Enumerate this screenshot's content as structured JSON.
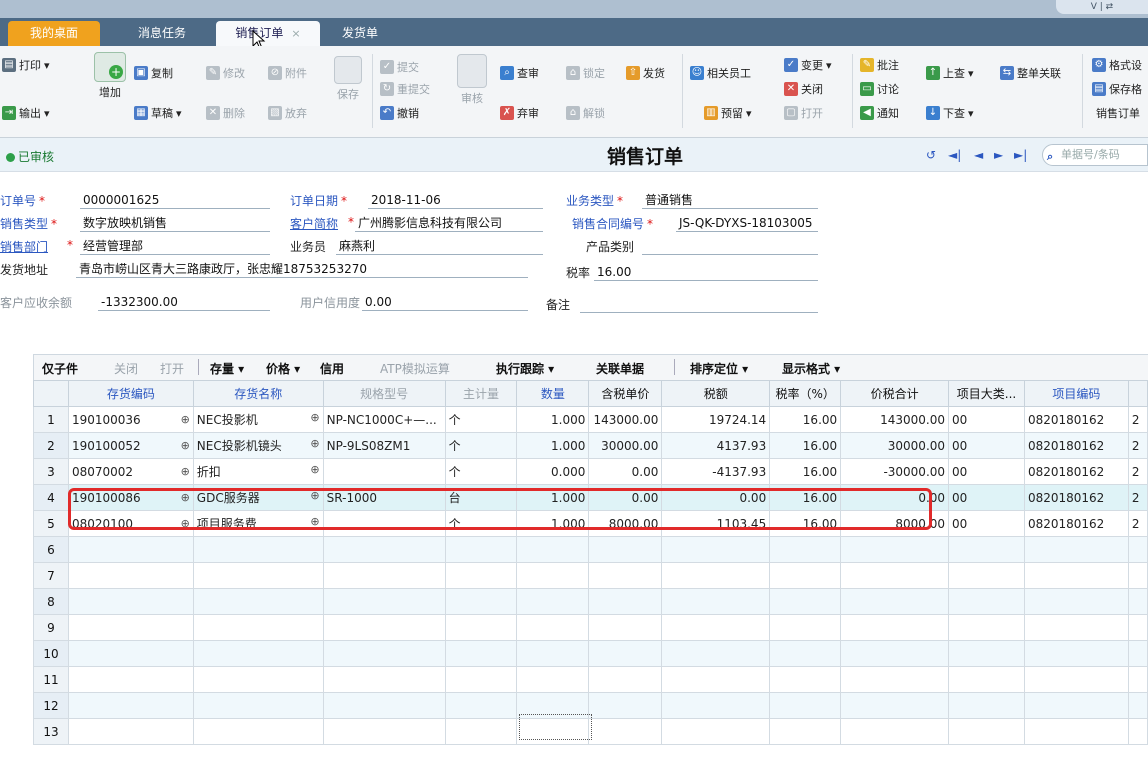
{
  "tabs": [
    {
      "label": "我的桌面"
    },
    {
      "label": "消息任务"
    },
    {
      "label": "销售订单",
      "close": "×"
    },
    {
      "label": "发货单"
    }
  ],
  "window_widget": "ᐯ | ⇄",
  "toolbar": {
    "print": "打印",
    "export": "输出",
    "add": "增加",
    "copy": "复制",
    "draft": "草稿",
    "modify": "修改",
    "attach": "附件",
    "delete": "删除",
    "discard": "放弃",
    "save": "保存",
    "submit": "提交",
    "resubmit": "重提交",
    "revoke": "撤销",
    "audit": "审核",
    "query_audit": "查审",
    "abandon_audit": "弃审",
    "lock": "锁定",
    "unlock": "解锁",
    "deliver": "发货",
    "related_staff": "相关员工",
    "reserve": "预留",
    "change": "变更",
    "close": "关闭",
    "open": "打开",
    "annotate": "批注",
    "discuss": "讨论",
    "notify": "通知",
    "query_up": "上查",
    "query_down": "下查",
    "whole_link": "整单关联",
    "format_set": "格式设",
    "save_format": "保存格",
    "sales_order": "销售订单"
  },
  "status": {
    "label": "已审核",
    "title": "销售订单",
    "search_placeholder": "单据号/条码",
    "nav": [
      "↺",
      "◄|",
      "◄",
      "►",
      "►|"
    ]
  },
  "form": {
    "order_no_label": "订单号",
    "order_no": "0000001625",
    "order_date_label": "订单日期",
    "order_date": "2018-11-06",
    "biz_type_label": "业务类型",
    "biz_type": "普通销售",
    "sales_type_label": "销售类型",
    "sales_type": "数字放映机销售",
    "customer_label": "客户简称",
    "customer": "广州腾影信息科技有限公司",
    "contract_label": "销售合同编号",
    "contract": "JS-QK-DYXS-18103005",
    "dept_label": "销售部门",
    "dept": "经营管理部",
    "salesman_label": "业务员",
    "salesman": "麻燕利",
    "product_label": "产品类别",
    "product": "",
    "ship_addr_label": "发货地址",
    "ship_addr": "青岛市崂山区青大三路康政厅，张忠耀18753253270",
    "tax_rate_label": "税率",
    "tax_rate": "16.00",
    "receivable_label": "客户应收余额",
    "receivable": "-1332300.00",
    "credit_label": "用户信用度",
    "credit": "0.00",
    "remark_label": "备注",
    "remark": ""
  },
  "gridbar": {
    "sub": "仅子件",
    "close": "关闭",
    "open": "打开",
    "stock": "存量 ▾",
    "price": "价格 ▾",
    "credit": "信用",
    "atp": "ATP模拟运算",
    "track": "执行跟踪 ▾",
    "related": "关联单据",
    "sort": "排序定位 ▾",
    "display": "显示格式 ▾"
  },
  "columns": [
    "存货编码",
    "存货名称",
    "规格型号",
    "主计量",
    "数量",
    "含税单价",
    "税额",
    "税率（%）",
    "价税合计",
    "项目大类...",
    "项目编码",
    ""
  ],
  "rows": [
    {
      "no": "1",
      "code": "190100036",
      "name": "NEC投影机",
      "spec": "NP-NC1000C+—...",
      "unit": "个",
      "qty": "1.000",
      "price": "143000.00",
      "tax": "19724.14",
      "rate": "16.00",
      "total": "143000.00",
      "cat": "00",
      "proj": "0820180162",
      "x": "2"
    },
    {
      "no": "2",
      "code": "190100052",
      "name": "NEC投影机镜头",
      "spec": "NP-9LS08ZM1",
      "unit": "个",
      "qty": "1.000",
      "price": "30000.00",
      "tax": "4137.93",
      "rate": "16.00",
      "total": "30000.00",
      "cat": "00",
      "proj": "0820180162",
      "x": "2"
    },
    {
      "no": "3",
      "code": "08070002",
      "name": "折扣",
      "spec": "",
      "unit": "个",
      "qty": "0.000",
      "price": "0.00",
      "tax": "-4137.93",
      "rate": "16.00",
      "total": "-30000.00",
      "cat": "00",
      "proj": "0820180162",
      "x": "2"
    },
    {
      "no": "4",
      "code": "190100086",
      "name": "GDC服务器",
      "spec": "SR-1000",
      "unit": "台",
      "qty": "1.000",
      "price": "0.00",
      "tax": "0.00",
      "rate": "16.00",
      "total": "0.00",
      "cat": "00",
      "proj": "0820180162",
      "x": "2"
    },
    {
      "no": "5",
      "code": "08020100",
      "name": "项目服务费",
      "spec": "",
      "unit": "个",
      "qty": "1.000",
      "price": "8000.00",
      "tax": "1103.45",
      "rate": "16.00",
      "total": "8000.00",
      "cat": "00",
      "proj": "0820180162",
      "x": "2"
    },
    {
      "no": "6"
    },
    {
      "no": "7"
    },
    {
      "no": "8"
    },
    {
      "no": "9"
    },
    {
      "no": "10"
    },
    {
      "no": "11"
    },
    {
      "no": "12"
    },
    {
      "no": "13"
    }
  ],
  "colors": {
    "tabbar": "#4d6a86",
    "orange": "#f0a21e",
    "link": "#2b57c0",
    "highlight": "#e12a2a",
    "audited": "#2da04a"
  }
}
